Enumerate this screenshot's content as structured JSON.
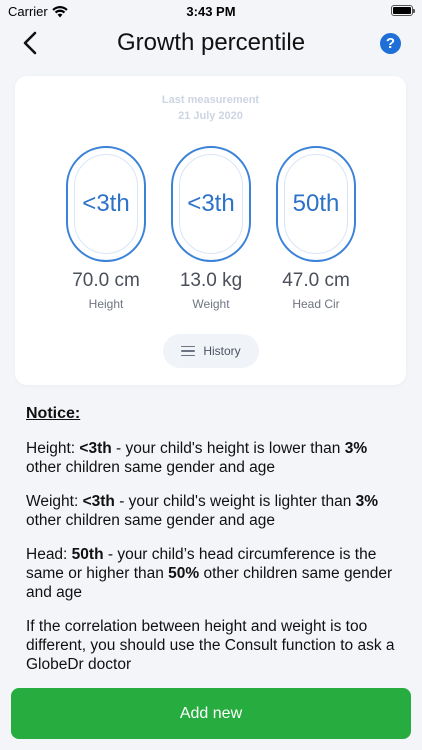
{
  "status_bar": {
    "carrier": "Carrier",
    "time": "3:43 PM"
  },
  "nav": {
    "title": "Growth percentile",
    "help": "?"
  },
  "card": {
    "last_measurement_label": "Last measurement",
    "last_measurement_date": "21 July  2020",
    "metrics": [
      {
        "percentile": "<3th",
        "value": "70.0 cm",
        "label": "Height"
      },
      {
        "percentile": "<3th",
        "value": "13.0 kg",
        "label": "Weight"
      },
      {
        "percentile": "50th",
        "value": "47.0 cm",
        "label": "Head Cir"
      }
    ],
    "history_label": "History"
  },
  "notice": {
    "title": "Notice:",
    "height": {
      "prefix": "Height: ",
      "pct": "<3th",
      "mid": " - your child's height is lower than ",
      "threshold": "3%",
      "suffix": " other children same gender and age"
    },
    "weight": {
      "prefix": "Weight: ",
      "pct": "<3th",
      "mid": " - your child's weight is lighter than ",
      "threshold": "3%",
      "suffix": " other children same gender and age"
    },
    "head": {
      "prefix": "Head: ",
      "pct": "50th",
      "mid": " - your child’s head circumference is the same or higher than ",
      "threshold": "50%",
      "suffix": " other children same gender and age"
    },
    "correlation": "If the correlation between height and weight is too different, you should use the Consult function to ask a GlobeDr doctor"
  },
  "add_button": "Add new",
  "colors": {
    "accent_blue": "#2c72c9",
    "green": "#27ac3f",
    "help_blue": "#1f6fd8"
  }
}
